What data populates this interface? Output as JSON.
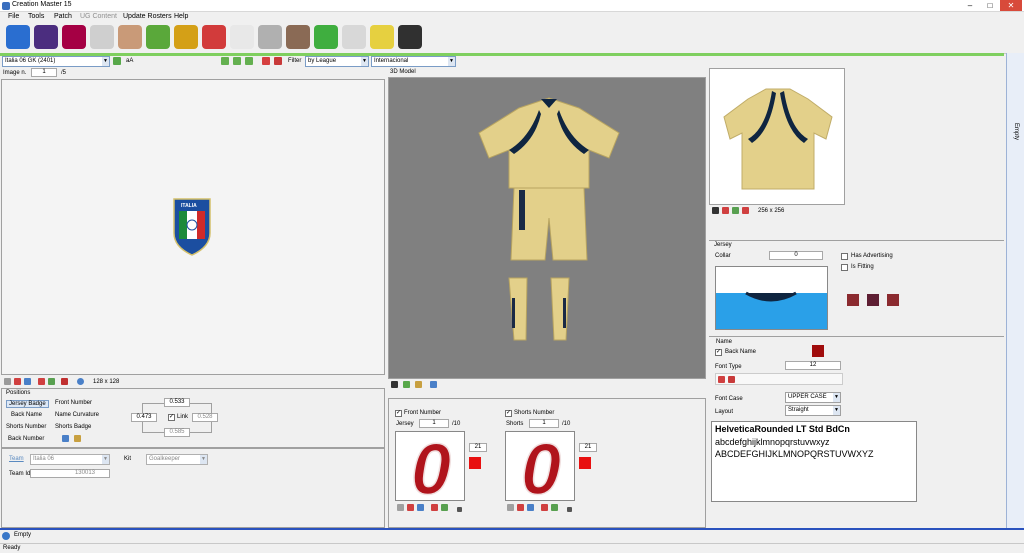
{
  "window": {
    "title": "Creation Master 15",
    "min": "–",
    "max": "□",
    "close": "✕"
  },
  "menu": [
    {
      "label": "File",
      "enabled": true
    },
    {
      "label": "Tools",
      "enabled": true
    },
    {
      "label": "Patch",
      "enabled": true
    },
    {
      "label": "UG Content",
      "enabled": false
    },
    {
      "label": "Update Rosters",
      "enabled": true
    },
    {
      "label": "Help",
      "enabled": true
    }
  ],
  "toolbar": {
    "icons": [
      {
        "name": "world-icon",
        "color": "#2a6ed0"
      },
      {
        "name": "premier-league-icon",
        "color": "#4b2d7f"
      },
      {
        "name": "barcelona-crest-icon",
        "color": "#a50044"
      },
      {
        "name": "jersey-icon",
        "color": "#cfcfcf"
      },
      {
        "name": "player-face-icon",
        "color": "#c99a78"
      },
      {
        "name": "stadium-icon",
        "color": "#5aa83a"
      },
      {
        "name": "trophy-icon",
        "color": "#d4a017"
      },
      {
        "name": "referee-cards-icon",
        "color": "#d23b3b"
      },
      {
        "name": "ball-icon",
        "color": "#e8e8e8"
      },
      {
        "name": "boots-icon",
        "color": "#b0b0b0"
      },
      {
        "name": "manager-icon",
        "color": "#8a6a55"
      },
      {
        "name": "pitch-icon",
        "color": "#3fae3f"
      },
      {
        "name": "newspaper-icon",
        "color": "#d8d8d8"
      },
      {
        "name": "glove-icon",
        "color": "#e6d040"
      },
      {
        "name": "headphones-icon",
        "color": "#303030"
      }
    ]
  },
  "filterbar": {
    "team_combo": "Italia 06 GK (2401)",
    "aa_label": "aA",
    "filter_label": "Filter",
    "filter_combo": "by League",
    "league_combo": "Internacional"
  },
  "left": {
    "image_n_label": "Image n.",
    "image_n_value": "1",
    "image_n_total": "/5",
    "badge_text": "ITALIA",
    "size_label": "128 x 128",
    "positions_title": "Positions",
    "positions": [
      "Jersey Badge",
      "Front Number",
      "Back Name",
      "Name Curvature",
      "Shorts Number",
      "Shorts Badge",
      "Back Number"
    ],
    "pos_top": "0.533",
    "pos_left": "0.473",
    "link_label": "Link",
    "pos_right": "0.528",
    "pos_bottom": "0.585",
    "team_label": "Team",
    "team_value": "Italia 06",
    "kit_label": "Kit",
    "kit_value": "Goalkeeper",
    "team_id_label": "Team Id",
    "team_id_value": "130013"
  },
  "center": {
    "model_label": "3D Model",
    "front_number_label": "Front Number",
    "jersey_label": "Jersey",
    "jersey_spin": "1",
    "jersey_total": "/10",
    "jersey_size": "21",
    "shorts_number_label": "Shorts Number",
    "shorts_label": "Shorts",
    "shorts_spin": "1",
    "shorts_total": "/10",
    "shorts_size": "21",
    "digit": "0",
    "number_color": "#b0141c",
    "swatch_color": "#e81010"
  },
  "right": {
    "preview_size": "256 x 256",
    "jersey_title": "Jersey",
    "collar_label": "Collar",
    "collar_value": "0",
    "has_advertising": "Has Advertising",
    "is_fitting": "Is Fitting",
    "swatches": [
      "#8b2a2f",
      "#5e1f33",
      "#8b2a2f"
    ],
    "name_title": "Name",
    "back_name_label": "Back Name",
    "back_name_color": "#a00c0c",
    "font_type_label": "Font Type",
    "font_type_value": "12",
    "font_case_label": "Font Case",
    "font_case_value": "UPPER CASE",
    "layout_label": "Layout",
    "layout_value": "Straight",
    "font_preview_1": "HelveticaRounded LT Std BdCn",
    "font_preview_2": "abcdefghijklmnopqrstuvwxyz",
    "font_preview_3": "ABCDEFGHIJKLMNOPQRSTUVWXYZ",
    "empty_tab": "Empty"
  },
  "bottom": {
    "empty_label": "Empty",
    "status": "Ready"
  }
}
